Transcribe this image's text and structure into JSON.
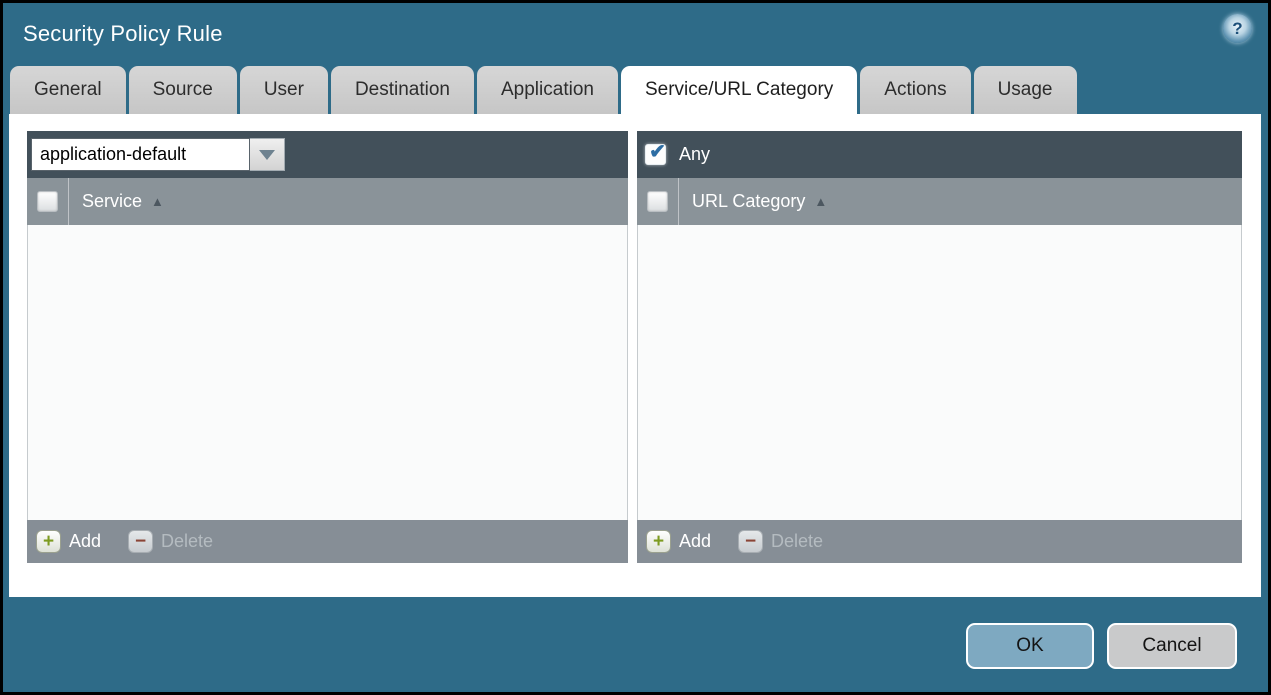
{
  "window": {
    "title": "Security Policy Rule"
  },
  "tabs": [
    {
      "label": "General",
      "active": false
    },
    {
      "label": "Source",
      "active": false
    },
    {
      "label": "User",
      "active": false
    },
    {
      "label": "Destination",
      "active": false
    },
    {
      "label": "Application",
      "active": false
    },
    {
      "label": "Service/URL Category",
      "active": true
    },
    {
      "label": "Actions",
      "active": false
    },
    {
      "label": "Usage",
      "active": false
    }
  ],
  "service_panel": {
    "dropdown_value": "application-default",
    "column_header": "Service",
    "select_all_checked": false,
    "rows": [],
    "add_label": "Add",
    "delete_label": "Delete",
    "delete_enabled": false
  },
  "url_panel": {
    "any_label": "Any",
    "any_checked": true,
    "column_header": "URL Category",
    "select_all_checked": false,
    "rows": [],
    "add_label": "Add",
    "delete_label": "Delete",
    "delete_enabled": false
  },
  "dialog_buttons": {
    "ok_label": "OK",
    "cancel_label": "Cancel"
  },
  "icons": {
    "help": "?",
    "sort_asc": "▲",
    "dropdown_arrow": "▼",
    "add": "+",
    "delete": "−",
    "check": "✔"
  },
  "colors": {
    "background_teal": "#2e6b88",
    "toolbar_dark": "#42505a",
    "table_header_gray": "#8a9399",
    "footer_gray": "#868e96",
    "panel_body": "#fafbfb",
    "tab_inactive": "#cccccc",
    "ok_button": "#7ea9c1",
    "cancel_button": "#c9cacb",
    "add_green": "#7d9b21",
    "delete_red": "#8a4436",
    "check_blue": "#2d6da3"
  }
}
